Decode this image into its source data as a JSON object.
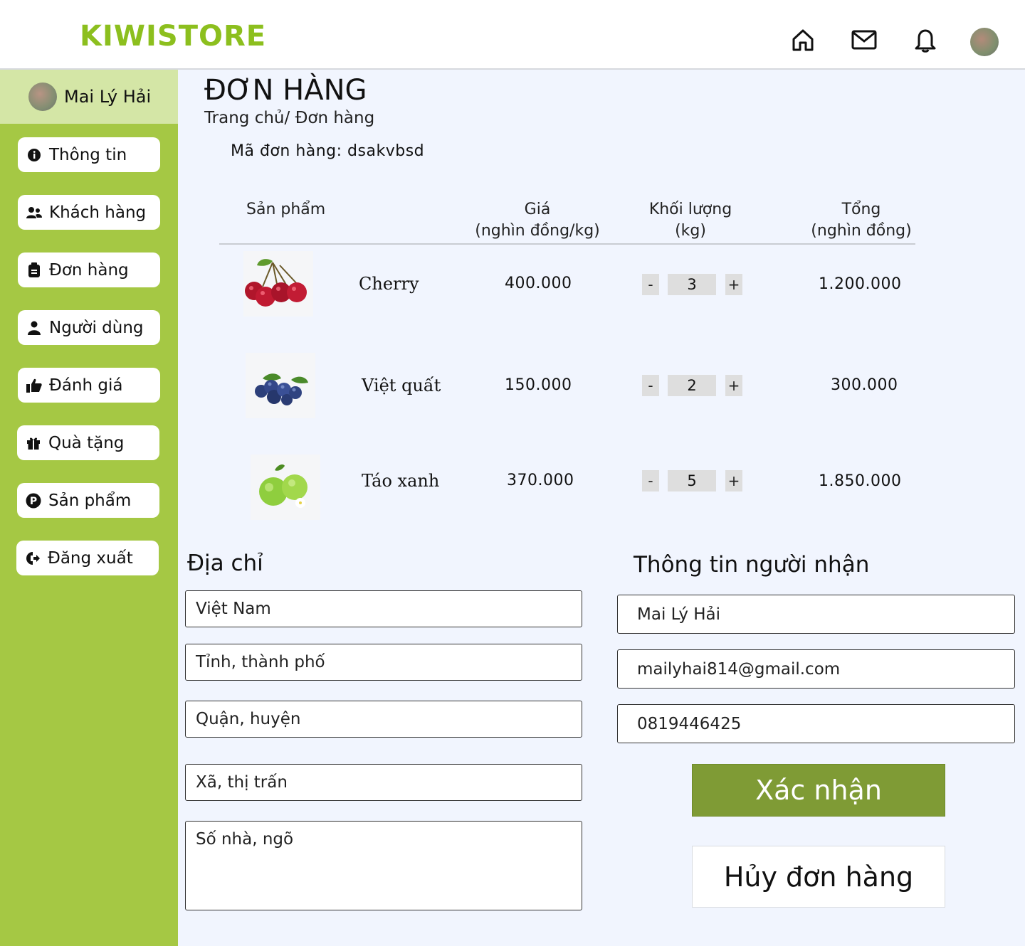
{
  "header": {
    "logo": "KIWISTORE",
    "icons": [
      "home-icon",
      "mail-icon",
      "bell-icon",
      "avatar"
    ]
  },
  "sidebar": {
    "user_name": "Mai Lý Hải",
    "items": [
      {
        "label": "Thông tin",
        "icon": "info-icon"
      },
      {
        "label": "Khách hàng",
        "icon": "users-icon"
      },
      {
        "label": "Đơn hàng",
        "icon": "order-icon"
      },
      {
        "label": "Người dùng",
        "icon": "user-icon"
      },
      {
        "label": "Đánh giá",
        "icon": "thumbs-up-icon"
      },
      {
        "label": "Quà tặng",
        "icon": "gift-icon"
      },
      {
        "label": "Sản phẩm",
        "icon": "product-icon"
      },
      {
        "label": "Đăng xuất",
        "icon": "logout-icon"
      }
    ]
  },
  "main": {
    "title": "ĐƠN HÀNG",
    "breadcrumb": "Trang chủ/ Đơn hàng",
    "order_code": "Mã đơn hàng: dsakvbsd",
    "table": {
      "headers": {
        "product": "Sản phẩm",
        "price_1": "Giá",
        "price_2": "(nghìn đồng/kg)",
        "qty_1": "Khối lượng",
        "qty_2": "(kg)",
        "total_1": "Tổng",
        "total_2": "(nghìn đồng)"
      },
      "rows": [
        {
          "name": "Cherry",
          "price": "400.000",
          "qty": "3",
          "total": "1.200.000",
          "image": "cherry-image"
        },
        {
          "name": "Việt quất",
          "price": "150.000",
          "qty": "2",
          "total": "300.000",
          "image": "blueberry-image"
        },
        {
          "name": "Táo xanh",
          "price": "370.000",
          "qty": "5",
          "total": "1.850.000",
          "image": "green-apple-image"
        }
      ],
      "minus_label": "-",
      "plus_label": "+"
    },
    "address": {
      "title": "Địa chỉ",
      "country": "Việt Nam",
      "province_placeholder": "Tỉnh, thành phố",
      "district_placeholder": "Quận, huyện",
      "ward_placeholder": "Xã, thị trấn",
      "street_placeholder": "Số nhà, ngõ"
    },
    "receiver": {
      "title": "Thông tin người nhận",
      "name": "Mai Lý Hải",
      "email": "mailyhai814@gmail.com",
      "phone": "0819446425"
    },
    "buttons": {
      "confirm": "Xác nhận",
      "cancel": "Hủy đơn hàng"
    }
  }
}
